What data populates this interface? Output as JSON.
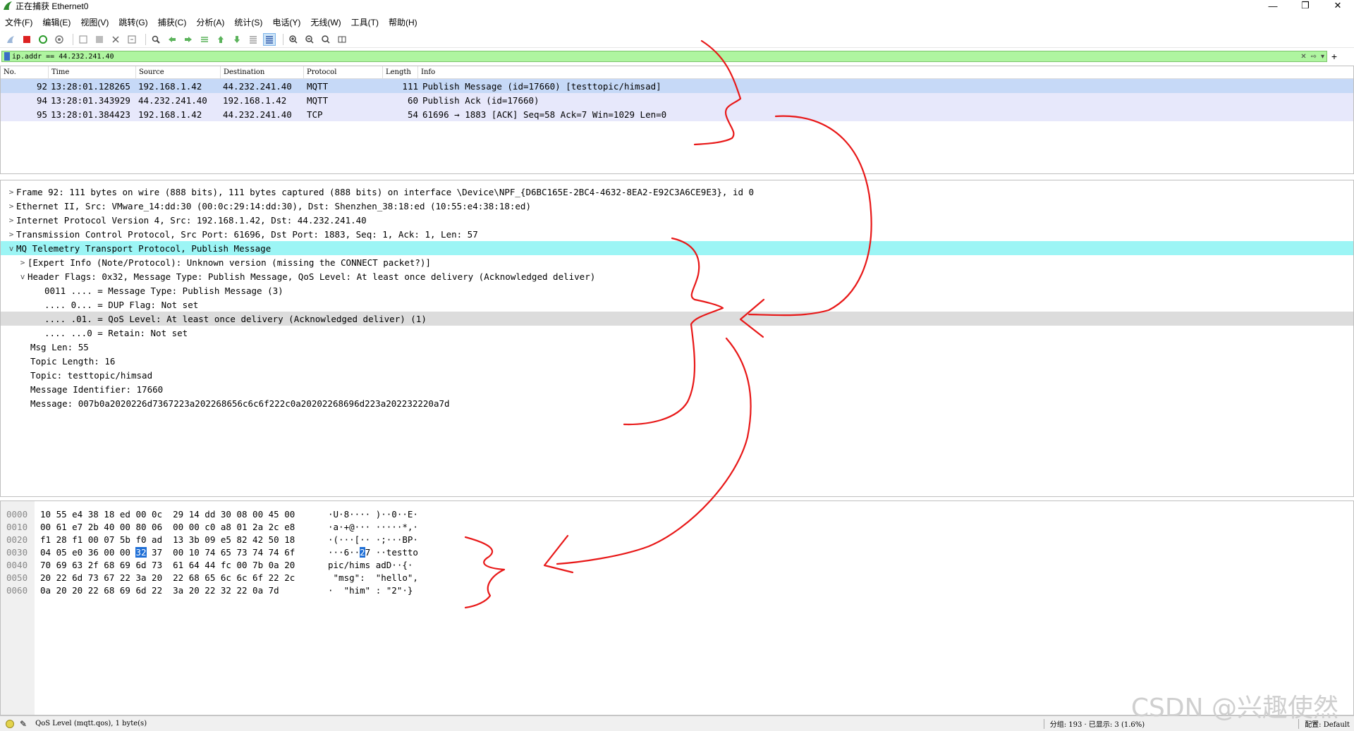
{
  "window": {
    "title": "正在捕获 Ethernet0",
    "controls": [
      "—",
      "❐",
      "✕"
    ]
  },
  "menu": [
    "文件(F)",
    "编辑(E)",
    "视图(V)",
    "跳转(G)",
    "捕获(C)",
    "分析(A)",
    "统计(S)",
    "电话(Y)",
    "无线(W)",
    "工具(T)",
    "帮助(H)"
  ],
  "filter": {
    "value": "ip.addr == 44.232.241.40"
  },
  "packet_list": {
    "columns": [
      "No.",
      "Time",
      "Source",
      "Destination",
      "Protocol",
      "Length",
      "Info"
    ],
    "rows": [
      {
        "no": "92",
        "time": "13:28:01.128265",
        "src": "192.168.1.42",
        "dst": "44.232.241.40",
        "proto": "MQTT",
        "len": "111",
        "info": "Publish Message (id=17660) [testtopic/himsad]"
      },
      {
        "no": "94",
        "time": "13:28:01.343929",
        "src": "44.232.241.40",
        "dst": "192.168.1.42",
        "proto": "MQTT",
        "len": "60",
        "info": "Publish Ack (id=17660)"
      },
      {
        "no": "95",
        "time": "13:28:01.384423",
        "src": "192.168.1.42",
        "dst": "44.232.241.40",
        "proto": "TCP",
        "len": "54",
        "info": "61696 → 1883 [ACK] Seq=58 Ack=7 Win=1029 Len=0"
      }
    ]
  },
  "details": [
    {
      "arrow": ">",
      "indent": 0,
      "text": "Frame 92: 111 bytes on wire (888 bits), 111 bytes captured (888 bits) on interface \\Device\\NPF_{D6BC165E-2BC4-4632-8EA2-E92C3A6CE9E3}, id 0"
    },
    {
      "arrow": ">",
      "indent": 0,
      "text": "Ethernet II, Src: VMware_14:dd:30 (00:0c:29:14:dd:30), Dst: Shenzhen_38:18:ed (10:55:e4:38:18:ed)"
    },
    {
      "arrow": ">",
      "indent": 0,
      "text": "Internet Protocol Version 4, Src: 192.168.1.42, Dst: 44.232.241.40"
    },
    {
      "arrow": ">",
      "indent": 0,
      "text": "Transmission Control Protocol, Src Port: 61696, Dst Port: 1883, Seq: 1, Ack: 1, Len: 57"
    },
    {
      "arrow": "v",
      "indent": 0,
      "text": "MQ Telemetry Transport Protocol, Publish Message"
    },
    {
      "arrow": ">",
      "indent": 1,
      "text": "[Expert Info (Note/Protocol): Unknown version (missing the CONNECT packet?)]"
    },
    {
      "arrow": "v",
      "indent": 1,
      "text": "Header Flags: 0x32, Message Type: Publish Message, QoS Level: At least once delivery (Acknowledged deliver)"
    },
    {
      "arrow": "",
      "indent": 2,
      "text": "0011 .... = Message Type: Publish Message (3)"
    },
    {
      "arrow": "",
      "indent": 2,
      "text": ".... 0... = DUP Flag: Not set"
    },
    {
      "arrow": "",
      "indent": 2,
      "text": ".... .01. = QoS Level: At least once delivery (Acknowledged deliver) (1)"
    },
    {
      "arrow": "",
      "indent": 2,
      "text": ".... ...0 = Retain: Not set"
    },
    {
      "arrow": "",
      "indent": 1,
      "text": "Msg Len: 55"
    },
    {
      "arrow": "",
      "indent": 1,
      "text": "Topic Length: 16"
    },
    {
      "arrow": "",
      "indent": 1,
      "text": "Topic: testtopic/himsad"
    },
    {
      "arrow": "",
      "indent": 1,
      "text": "Message Identifier: 17660"
    },
    {
      "arrow": "",
      "indent": 1,
      "text": "Message: 007b0a2020226d7367223a202268656c6c6f222c0a20202268696d223a202232220a7d"
    }
  ],
  "hex": [
    {
      "off": "0000",
      "a": "10 55 e4 38 18 ed 00 0c",
      "b": "29 14 dd 30 08 00 45 00",
      "asc": "·U·8···· )··0··E·"
    },
    {
      "off": "0010",
      "a": "00 61 e7 2b 40 00 80 06",
      "b": "00 00 c0 a8 01 2a 2c e8",
      "asc": "·a·+@··· ·····*,·"
    },
    {
      "off": "0020",
      "a": "f1 28 f1 00 07 5b f0 ad",
      "b": "13 3b 09 e5 82 42 50 18",
      "asc": "·(···[·· ·;···BP·"
    },
    {
      "off": "0030",
      "a1": "04 05 e0 36 00 00 ",
      "sel": "32",
      "a2": " 37",
      "b": "00 10 74 65 73 74 74 6f",
      "asc1": "···6··",
      "ascsel": "2",
      "asc2": "7 ··testto"
    },
    {
      "off": "0040",
      "a": "70 69 63 2f 68 69 6d 73",
      "b": "61 64 44 fc 00 7b 0a 20",
      "asc": "pic/hims adD··{· "
    },
    {
      "off": "0050",
      "a": "20 22 6d 73 67 22 3a 20",
      "b": "22 68 65 6c 6c 6f 22 2c",
      "asc": " \"msg\":  \"hello\","
    },
    {
      "off": "0060",
      "a": "0a 20 20 22 68 69 6d 22",
      "b": "3a 20 22 32 22 0a 7d",
      "asc": "·  \"him\" : \"2\"·}"
    }
  ],
  "status": {
    "message": "QoS Level (mqtt.qos), 1 byte(s)",
    "packets": "分组: 193 · 已显示: 3 (1.6%)",
    "profile": "配置: Default"
  },
  "watermark": "CSDN @兴趣使然"
}
